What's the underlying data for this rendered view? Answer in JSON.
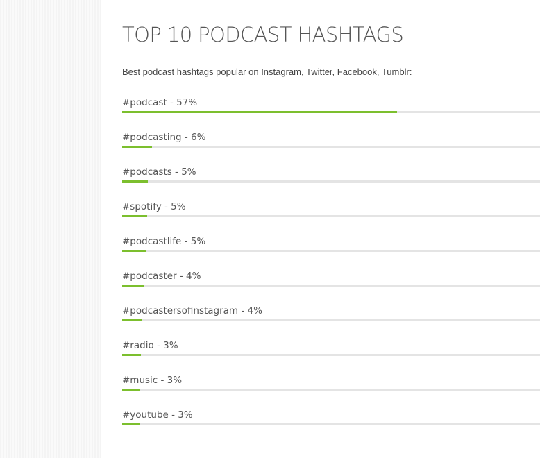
{
  "page": {
    "title": "TOP 10 PODCAST HASHTAGS",
    "subtitle": "Best podcast hashtags popular on Instagram, Twitter, Facebook, Tumblr:"
  },
  "colors": {
    "bar_fill": "#7cbf2e",
    "bar_track": "#e4e4e4",
    "text": "#555555"
  },
  "hashtags": [
    {
      "tag": "#podcast",
      "percent": 57,
      "label": "#podcast - 57%",
      "bar_fraction": 0.658
    },
    {
      "tag": "#podcasting",
      "percent": 6,
      "label": "#podcasting - 6%",
      "bar_fraction": 0.071
    },
    {
      "tag": "#podcasts",
      "percent": 5,
      "label": "#podcasts - 5%",
      "bar_fraction": 0.061
    },
    {
      "tag": "#spotify",
      "percent": 5,
      "label": "#spotify - 5%",
      "bar_fraction": 0.06
    },
    {
      "tag": "#podcastlife",
      "percent": 5,
      "label": "#podcastlife - 5%",
      "bar_fraction": 0.058
    },
    {
      "tag": "#podcaster",
      "percent": 4,
      "label": "#podcaster - 4%",
      "bar_fraction": 0.053
    },
    {
      "tag": "#podcastersofinstagram",
      "percent": 4,
      "label": "#podcastersofinstagram - 4%",
      "bar_fraction": 0.048
    },
    {
      "tag": "#radio",
      "percent": 3,
      "label": "#radio - 3%",
      "bar_fraction": 0.045
    },
    {
      "tag": "#music",
      "percent": 3,
      "label": "#music - 3%",
      "bar_fraction": 0.043
    },
    {
      "tag": "#youtube",
      "percent": 3,
      "label": "#youtube - 3%",
      "bar_fraction": 0.041
    }
  ]
}
